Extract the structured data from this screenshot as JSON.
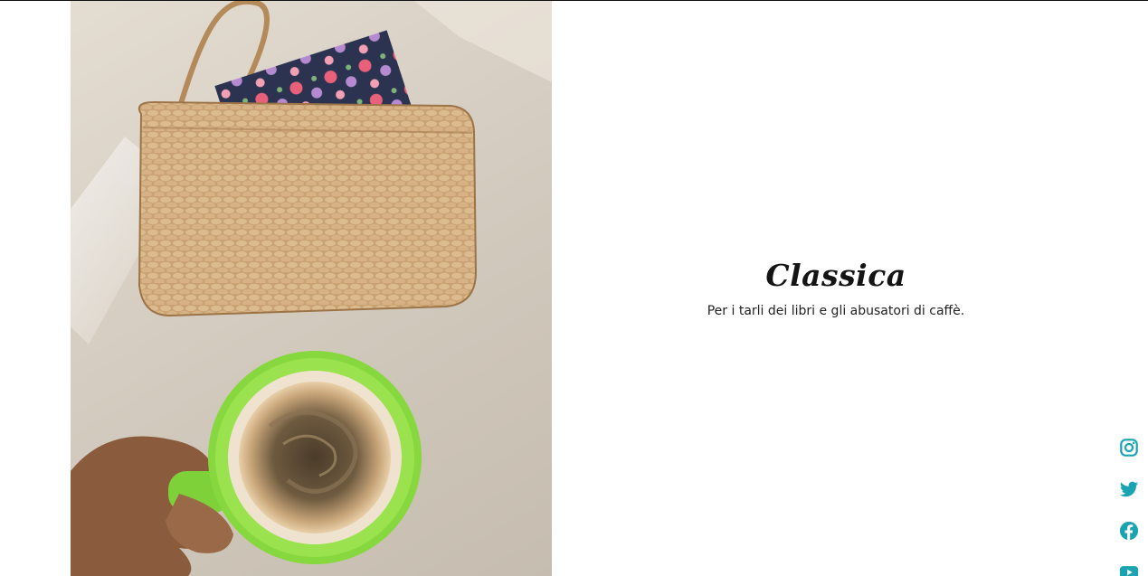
{
  "product": {
    "title": "Classica",
    "tagline": "Per i tarli dei libri e gli abusatori di caffè."
  },
  "social": {
    "color": "#1aa3b0",
    "links": [
      {
        "icon": "instagram-icon"
      },
      {
        "icon": "twitter-icon"
      },
      {
        "icon": "facebook-icon"
      },
      {
        "icon": "youtube-icon"
      }
    ]
  }
}
